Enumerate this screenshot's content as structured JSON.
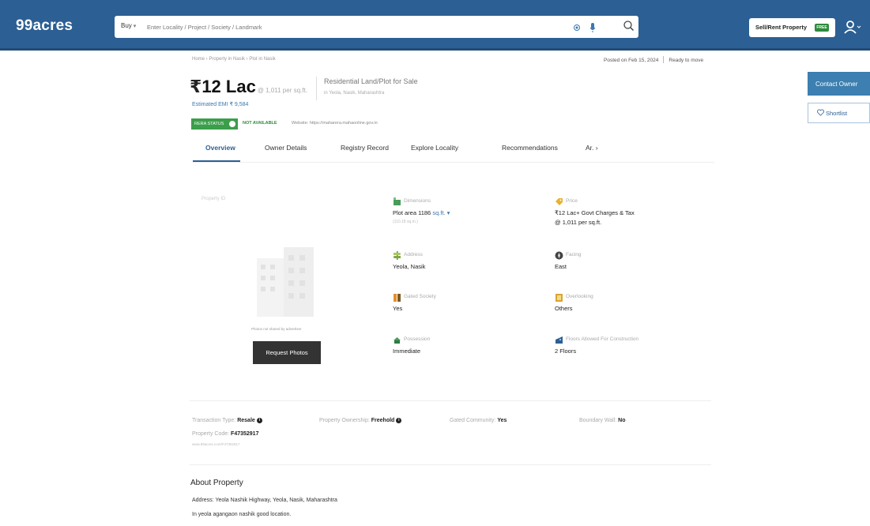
{
  "header": {
    "logo": "99acres",
    "buy_label": "Buy",
    "search_placeholder": "Enter Locality / Project / Society / Landmark",
    "post_label": "Sell/Rent Property",
    "post_badge": "FREE",
    "brand_color": "#2c5f93"
  },
  "sidebar": {
    "contact_label": "Contact Owner",
    "shortlist_label": "Shortlist"
  },
  "breadcrumb": "Home › Property in Nasik › Plot in Nasik",
  "meta": {
    "posted": "Posted on Feb 15, 2024",
    "ready": "Ready to move"
  },
  "price": {
    "symbol": "₹",
    "value": "12 Lac",
    "per_sqft": "@ 1,011 per sq.ft.",
    "emi": "Estimated EMI ₹ 9,584"
  },
  "property": {
    "title": "Residential Land/Plot for Sale",
    "location": "in Yeola, Nasik, Maharashtra"
  },
  "rera": {
    "badge": "RERA STATUS",
    "status": "NOT AVAILABLE",
    "website": "Website: https://maharera.mahaonline.gov.in"
  },
  "tabs": [
    "Overview",
    "Owner Details",
    "Registry Record",
    "Explore Locality",
    "Recommendations",
    "Ar. ›"
  ],
  "photo": {
    "label": "Property ID",
    "note": "Photos not shared by advertiser",
    "request_label": "Request Photos"
  },
  "attributes": {
    "dimensions": {
      "label": "Dimensions",
      "value": "Plot area 1186",
      "unit": "sq.ft.",
      "sub": "(110.18 sq.m.)"
    },
    "price": {
      "label": "Price",
      "value": "₹12 Lac+ Govt Charges & Tax",
      "sub": "@ 1,011 per sq.ft."
    },
    "address": {
      "label": "Address",
      "value": "Yeola, Nasik"
    },
    "facing": {
      "label": "Facing",
      "value": "East"
    },
    "gated_society": {
      "label": "Gated Society",
      "value": "Yes"
    },
    "overlooking": {
      "label": "Overlooking",
      "value": "Others"
    },
    "possession": {
      "label": "Possession",
      "value": "Immediate"
    },
    "floors": {
      "label": "Floors Allowed For Construction",
      "value": "2 Floors"
    }
  },
  "summary": {
    "transaction_label": "Transaction Type:",
    "transaction_value": "Resale",
    "ownership_label": "Property Ownership:",
    "ownership_value": "Freehold",
    "gated_label": "Gated Community:",
    "gated_value": "Yes",
    "boundary_label": "Boundary Wall:",
    "boundary_value": "No",
    "code_label": "Property Code:",
    "code_value": "F47352917",
    "code_url": "www.99acres.com/F47352917"
  },
  "about": {
    "heading": "About Property",
    "address": "Address: Yeola Nashik Highway, Yeola, Nasik, Maharashtra",
    "description": "In yeola agangaon nashik good location."
  }
}
